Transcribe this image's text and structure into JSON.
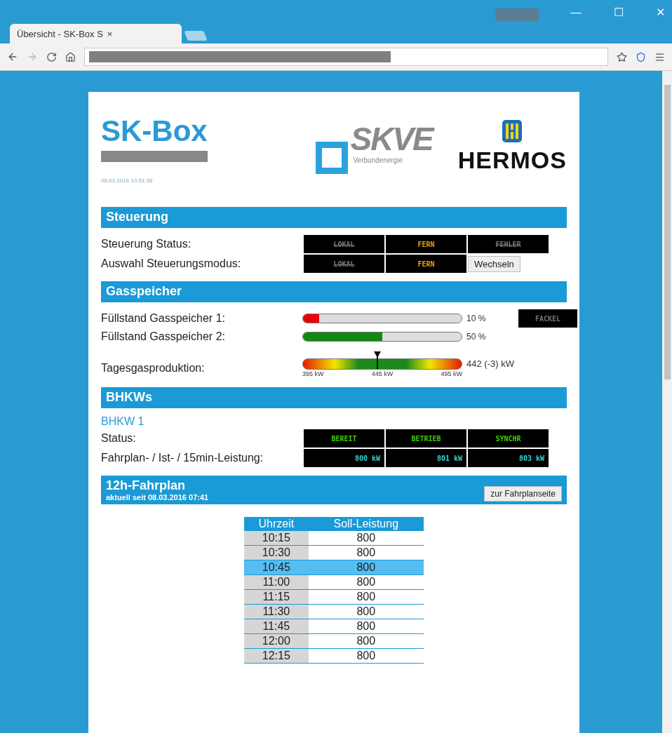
{
  "browser": {
    "tab_title": "Übersicht - SK-Box S",
    "tab_close": "×",
    "window_controls": [
      "—",
      "☐",
      "✕"
    ]
  },
  "header": {
    "title": "SK-Box",
    "timestamp": "08.03.2016 10:51:38",
    "skve_logo": "SKVE",
    "skve_subtitle": "Verbundenergie",
    "hermos_logo": "HERMOS"
  },
  "steuerung": {
    "title": "Steuerung",
    "rows": [
      {
        "label": "Steuerung Status:",
        "indicators": [
          {
            "text": "LOKAL",
            "active": false
          },
          {
            "text": "FERN",
            "active": true
          },
          {
            "text": "FEHLER",
            "active": false
          }
        ]
      },
      {
        "label": "Auswahl Steuerungsmodus:",
        "indicators": [
          {
            "text": "LOKAL",
            "active": false
          },
          {
            "text": "FERN",
            "active": true
          }
        ],
        "button": "Wechseln"
      }
    ]
  },
  "gasspeicher": {
    "title": "Gasspeicher",
    "tanks": [
      {
        "label": "Füllstand Gasspeicher 1:",
        "level": 0.1,
        "color": "#e8000b",
        "reading": "10 %"
      },
      {
        "label": "Füllstand Gasspeicher 2:",
        "level": 0.5,
        "color": "#118811",
        "reading": "50 %"
      }
    ],
    "fackel": {
      "text": "FACKEL",
      "active": false
    },
    "production": {
      "label": "Tagesgasproduktion:",
      "level": 0.47,
      "reading": "442 (-3) kW",
      "ticks": [
        "395 kW",
        "445 kW",
        "495 kW"
      ]
    }
  },
  "bhkws": {
    "title": "BHKWs",
    "units": [
      {
        "name": "BHKW 1",
        "status_label": "Status:",
        "status": [
          {
            "text": "BEREIT",
            "active": true
          },
          {
            "text": "BETRIEB",
            "active": true
          },
          {
            "text": "SYNCHR",
            "active": true
          }
        ],
        "power_label": "Fahrplan- / Ist- / 15min-Leistung:",
        "power": [
          "800 kW",
          "801 kW",
          "803 kW"
        ]
      }
    ]
  },
  "fahrplan": {
    "title": "12h-Fahrplan",
    "subtitle": "aktuell seit 08.03.2016 07:41",
    "button": "zur Fahrplanseite",
    "columns": [
      "Uhrzeit",
      "Soll-Leistung"
    ],
    "rows": [
      {
        "time": "10:15",
        "value": "800",
        "selected": false
      },
      {
        "time": "10:30",
        "value": "800",
        "selected": false
      },
      {
        "time": "10:45",
        "value": "800",
        "selected": true
      },
      {
        "time": "11:00",
        "value": "800",
        "selected": false
      },
      {
        "time": "11:15",
        "value": "800",
        "selected": false
      },
      {
        "time": "11:30",
        "value": "800",
        "selected": false
      },
      {
        "time": "11:45",
        "value": "800",
        "selected": false
      },
      {
        "time": "12:00",
        "value": "800",
        "selected": false
      },
      {
        "time": "12:15",
        "value": "800",
        "selected": false
      }
    ]
  }
}
